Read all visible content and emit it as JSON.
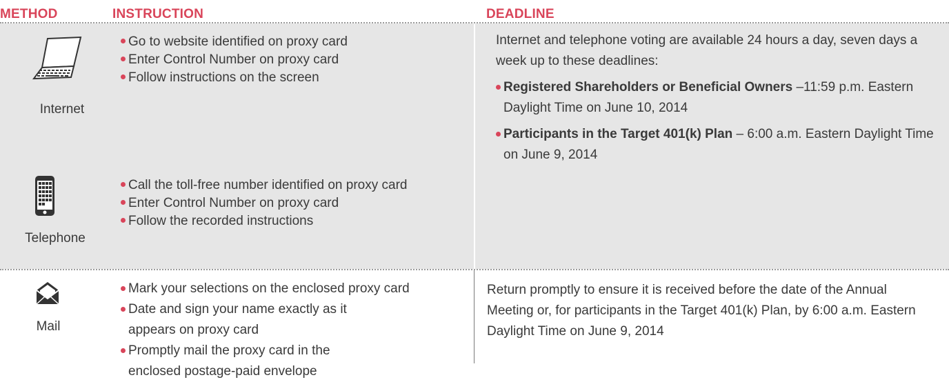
{
  "colors": {
    "accent": "#d9455a",
    "band": "#e6e6e6",
    "text": "#3a3a3a"
  },
  "headers": {
    "method": "METHOD",
    "instruction": "INSTRUCTION",
    "deadline": "DEADLINE"
  },
  "methods": [
    {
      "label": "Internet",
      "icon": "laptop-icon",
      "instructions": [
        "Go to website identified on proxy card",
        "Enter Control Number on proxy card",
        "Follow instructions on the screen"
      ]
    },
    {
      "label": "Telephone",
      "icon": "smartphone-icon",
      "instructions": [
        "Call the toll-free number identified on proxy card",
        "Enter Control Number on proxy card",
        "Follow the recorded instructions"
      ]
    },
    {
      "label": "Mail",
      "icon": "envelope-icon",
      "instructions": [
        "Mark your selections on the enclosed proxy card",
        "Date and sign your name exactly as it appears on proxy card",
        "Promptly mail the proxy card in the enclosed postage-paid envelope"
      ]
    }
  ],
  "deadlines": {
    "online": {
      "intro": "Internet and telephone voting are available 24 hours a day, seven days a week up to these deadlines:",
      "items": [
        {
          "bold": "Registered Shareholders or Beneficial Owners",
          "rest": " –11:59 p.m. Eastern Daylight Time on June 10, 2014"
        },
        {
          "bold": "Participants in the Target 401(k) Plan",
          "rest": " – 6:00 a.m. Eastern Daylight Time on June 9, 2014"
        }
      ]
    },
    "mail": "Return promptly to ensure it is received before the date of the Annual Meeting or, for participants in the Target 401(k) Plan, by 6:00 a.m. Eastern Daylight Time on June 9, 2014"
  }
}
